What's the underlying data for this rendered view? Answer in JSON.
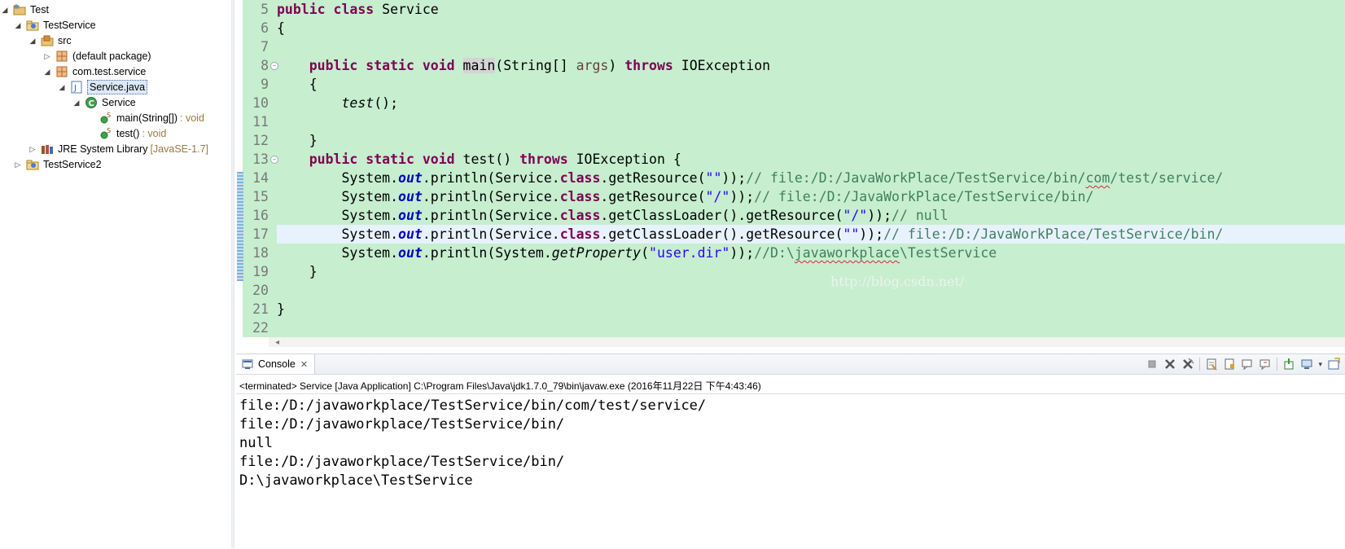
{
  "explorer": {
    "items": [
      {
        "label": "Test"
      },
      {
        "label": "TestService"
      },
      {
        "label": "src"
      },
      {
        "label": "(default package)"
      },
      {
        "label": "com.test.service"
      },
      {
        "label": "Service.java"
      },
      {
        "label": "Service"
      },
      {
        "label": "main(String[])",
        "detail": ": void"
      },
      {
        "label": "test()",
        "detail": ": void"
      },
      {
        "label": "JRE System Library",
        "detail": "[JavaSE-1.7]"
      },
      {
        "label": "TestService2"
      }
    ]
  },
  "editor": {
    "line_numbers": [
      "5",
      "6",
      "7",
      "8",
      "9",
      "10",
      "11",
      "12",
      "13",
      "14",
      "15",
      "16",
      "17",
      "18",
      "19",
      "20",
      "21",
      "22"
    ],
    "lines": {
      "l5": {
        "kw1": "public",
        "kw2": "class",
        "name": "Service"
      },
      "l6": {
        "text": "{"
      },
      "l8": {
        "kw1": "public",
        "kw2": "static",
        "kw3": "void",
        "method": "main",
        "args_open": "(String[] ",
        "param": "args",
        "args_close": ") ",
        "kw4": "throws",
        "exc": "IOException"
      },
      "l9": {
        "text": "{"
      },
      "l10": {
        "call": "test",
        "rest": "();"
      },
      "l12": {
        "text": "}"
      },
      "l13": {
        "kw1": "public",
        "kw2": "static",
        "kw3": "void",
        "rest1": "test() ",
        "kw4": "throws",
        "rest2": "IOException {"
      },
      "l14": {
        "p1": "System.",
        "out": "out",
        "p2": ".println(Service.",
        "cls": "class",
        "p3": ".getResource(",
        "s": "\"\"",
        "p4": "));",
        "c1": "// file:/D:/JavaWorkPlace/TestService/bin/",
        "c2": "com",
        "c3": "/test/service/"
      },
      "l15": {
        "p1": "System.",
        "out": "out",
        "p2": ".println(Service.",
        "cls": "class",
        "p3": ".getResource(",
        "s": "\"/\"",
        "p4": "));",
        "c": "// file:/D:/JavaWorkPlace/TestService/bin/"
      },
      "l16": {
        "p1": "System.",
        "out": "out",
        "p2": ".println(Service.",
        "cls": "class",
        "p3": ".getClassLoader().getResource(",
        "s": "\"/\"",
        "p4": "));",
        "c": "// null"
      },
      "l17": {
        "p1": "System.",
        "out": "out",
        "p2": ".println(Service.",
        "cls": "class",
        "p3": ".getClassLoader().getResource(",
        "s": "\"\"",
        "p4": "));",
        "c": "// file:/D:/JavaWorkPlace/TestService/bin/"
      },
      "l18": {
        "p1": "System.",
        "out": "out",
        "p2": ".println(System.",
        "gp": "getProperty",
        "p3": "(",
        "s": "\"user.dir\"",
        "p4": "));",
        "c1": "//D:\\",
        "c2": "javaworkplace",
        "c3": "\\TestService"
      },
      "l19": {
        "text": "}"
      },
      "l21": {
        "text": "}"
      }
    },
    "watermark": "http://blog.csdn.net/"
  },
  "console": {
    "tab_label": "Console",
    "status": "<terminated> Service [Java Application] C:\\Program Files\\Java\\jdk1.7.0_79\\bin\\javaw.exe (2016年11月22日 下午4:43:46)",
    "output": [
      "file:/D:/javaworkplace/TestService/bin/com/test/service/",
      "file:/D:/javaworkplace/TestService/bin/",
      "null",
      "file:/D:/javaworkplace/TestService/bin/",
      "D:\\javaworkplace\\TestService"
    ]
  },
  "colors": {
    "editor_bg": "#c7eecf",
    "keyword": "#7f0055",
    "string": "#2a00ff",
    "comment": "#3f7f5f",
    "field": "#0000c0"
  }
}
